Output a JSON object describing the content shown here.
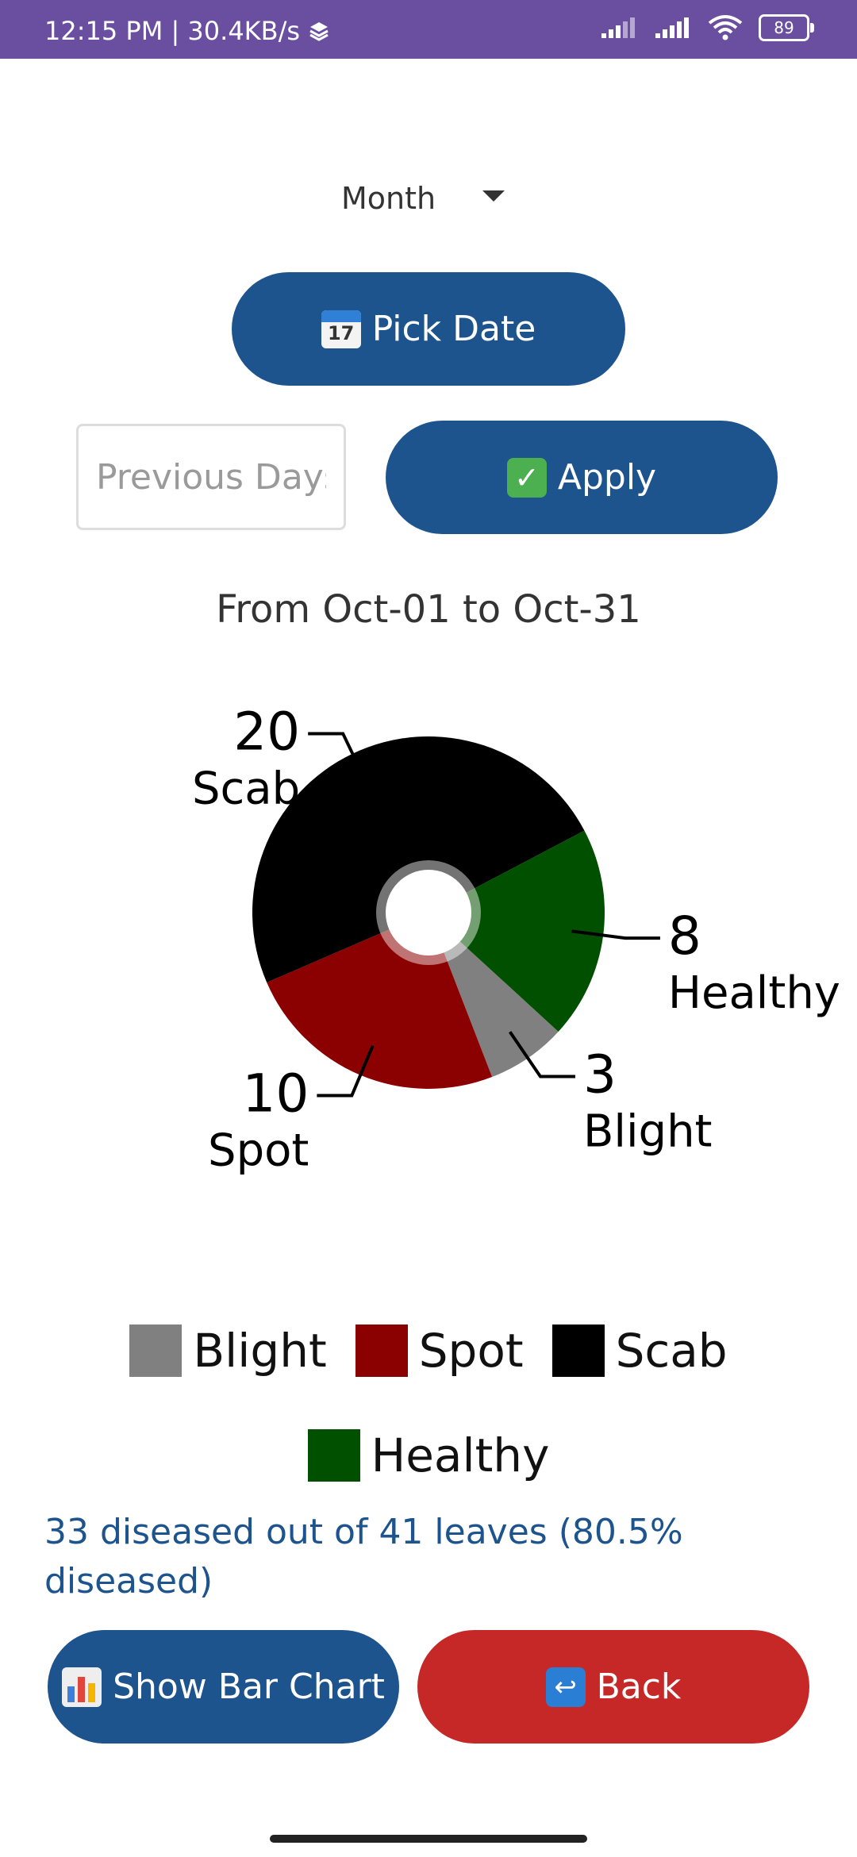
{
  "status_bar": {
    "time_speed": "12:15 PM | 30.4KB/s",
    "battery": "89"
  },
  "filters": {
    "period_select": "Month",
    "pick_date_label": "Pick Date",
    "previous_days_placeholder": "Previous Days",
    "apply_label": "Apply"
  },
  "date_range": "From Oct-01 to Oct-31",
  "chart_data": {
    "type": "pie",
    "title": "",
    "slices": [
      {
        "name": "Blight",
        "value": 3,
        "color": "#808080"
      },
      {
        "name": "Spot",
        "value": 10,
        "color": "#8b0000"
      },
      {
        "name": "Scab",
        "value": 20,
        "color": "#000000"
      },
      {
        "name": "Healthy",
        "value": 8,
        "color": "#005000"
      }
    ],
    "legend": [
      "Blight",
      "Spot",
      "Scab",
      "Healthy"
    ],
    "legend_placement": "bottom"
  },
  "summary": "33 diseased out of 41 leaves (80.5% diseased)",
  "actions": {
    "bar_chart_label": "Show Bar Chart",
    "back_label": "Back"
  },
  "colors": {
    "status_bar": "#6a4fa0",
    "primary_button": "#1d548e",
    "back_button": "#c62828"
  }
}
